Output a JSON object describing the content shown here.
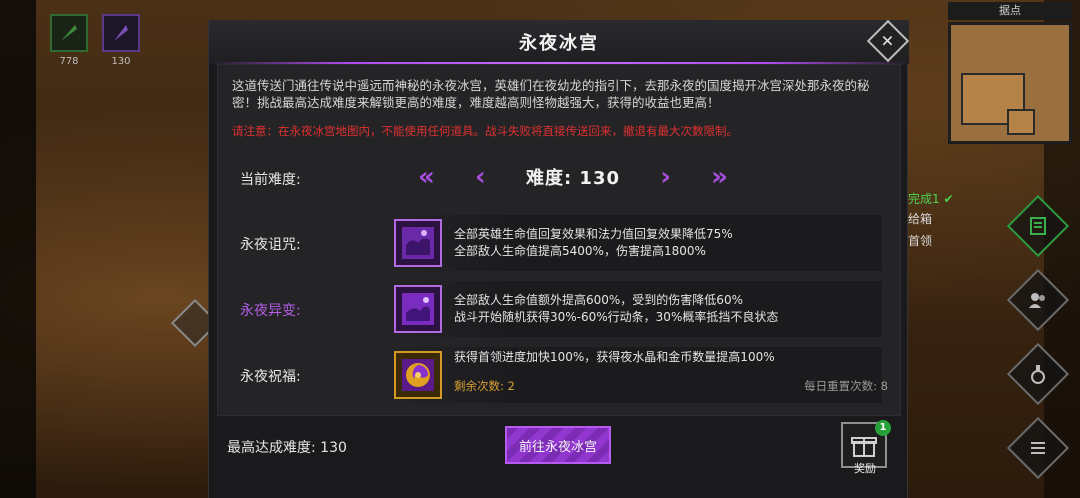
{
  "hud": {
    "skill_counts": [
      "778",
      "130"
    ],
    "map_title": "据点",
    "quest_done": "完成1 ✔",
    "quest_line1": "给箱",
    "quest_line2": "首领"
  },
  "modal": {
    "title": "永夜冰宫",
    "description": "这道传送门通往传说中遥远而神秘的永夜冰宫，英雄们在夜幼龙的指引下，去那永夜的国度揭开冰宫深处那永夜的秘密！挑战最高达成难度来解锁更高的难度，难度越高则怪物越强大，获得的收益也更高！",
    "warning": "请注意：在永夜冰宫地图内，不能使用任何道具。战斗失败将直接传送回来，撤退有最大次数限制。",
    "difficulty": {
      "label": "当前难度:",
      "value_text": "难度: 130",
      "first_icon": "«",
      "prev_icon": "‹",
      "next_icon": "›",
      "last_icon": "»"
    },
    "curse": {
      "label": "永夜诅咒:",
      "line1": "全部英雄生命值回复效果和法力值回复效果降低75%",
      "line2": "全部敌人生命值提高5400%，伤害提高1800%"
    },
    "mutation": {
      "label": "永夜异变:",
      "line1": "全部敌人生命值额外提高600%，受到的伤害降低60%",
      "line2": "战斗开始随机获得30%-60%行动条，30%概率抵挡不良状态"
    },
    "blessing": {
      "label": "永夜祝福:",
      "line1": "获得首领进度加快100%，获得夜水晶和金币数量提高100%",
      "remaining": "剩余次数: 2",
      "daily_reset": "每日重置次数: 8"
    },
    "best_difficulty": "最高达成难度: 130",
    "go_button": "前往永夜冰宫",
    "reward_label": "奖励",
    "reward_badge": "1"
  },
  "colors": {
    "accent_purple": "#b04cf0",
    "warning_red": "#e03030",
    "remaining_gold": "#d7a132"
  }
}
